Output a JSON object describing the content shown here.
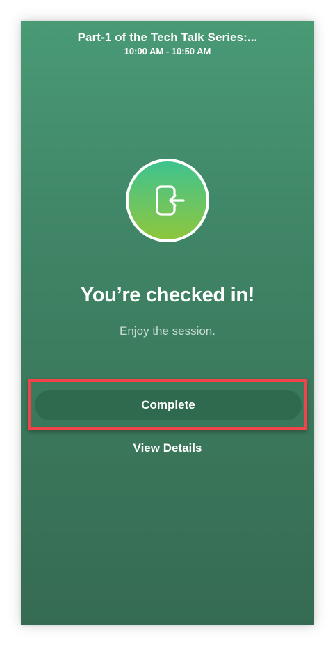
{
  "header": {
    "title": "Part-1 of the Tech Talk Series:...",
    "time": "10:00 AM - 10:50 AM"
  },
  "status_icon": "check-in-door-arrow-icon",
  "main": {
    "headline": "You’re checked in!",
    "subtext": "Enjoy the session."
  },
  "actions": {
    "complete_label": "Complete",
    "details_label": "View Details"
  },
  "colors": {
    "background_top": "#4a9a76",
    "background_bottom": "#356b53",
    "button": "#2f6a4e",
    "highlight": "#f2434b",
    "icon_gradient_top": "#3ec38e",
    "icon_gradient_bottom": "#8ec63c"
  }
}
